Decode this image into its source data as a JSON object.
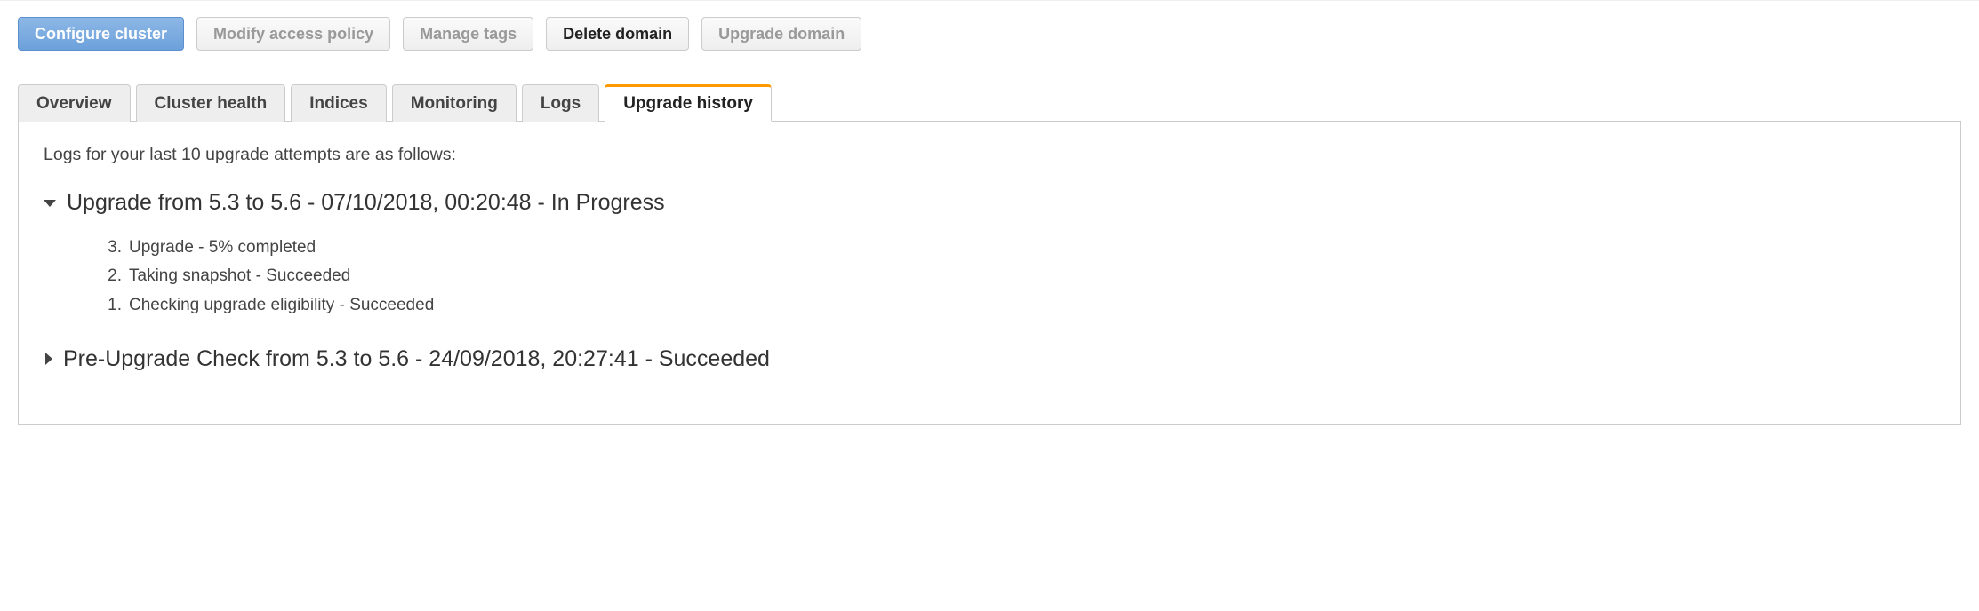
{
  "toolbar": {
    "configure": "Configure cluster",
    "modify_policy": "Modify access policy",
    "manage_tags": "Manage tags",
    "delete_domain": "Delete domain",
    "upgrade_domain": "Upgrade domain"
  },
  "tabs": {
    "overview": "Overview",
    "cluster_health": "Cluster health",
    "indices": "Indices",
    "monitoring": "Monitoring",
    "logs": "Logs",
    "upgrade_history": "Upgrade history"
  },
  "panel": {
    "intro": "Logs for your last 10 upgrade attempts are as follows:"
  },
  "entries": [
    {
      "expanded": true,
      "title": "Upgrade from 5.3 to 5.6 - 07/10/2018, 00:20:48 - In Progress",
      "steps": [
        {
          "n": "3.",
          "text": "Upgrade - 5% completed"
        },
        {
          "n": "2.",
          "text": "Taking snapshot - Succeeded"
        },
        {
          "n": "1.",
          "text": "Checking upgrade eligibility - Succeeded"
        }
      ]
    },
    {
      "expanded": false,
      "title": "Pre-Upgrade Check from 5.3 to 5.6 - 24/09/2018, 20:27:41 - Succeeded",
      "steps": []
    }
  ]
}
